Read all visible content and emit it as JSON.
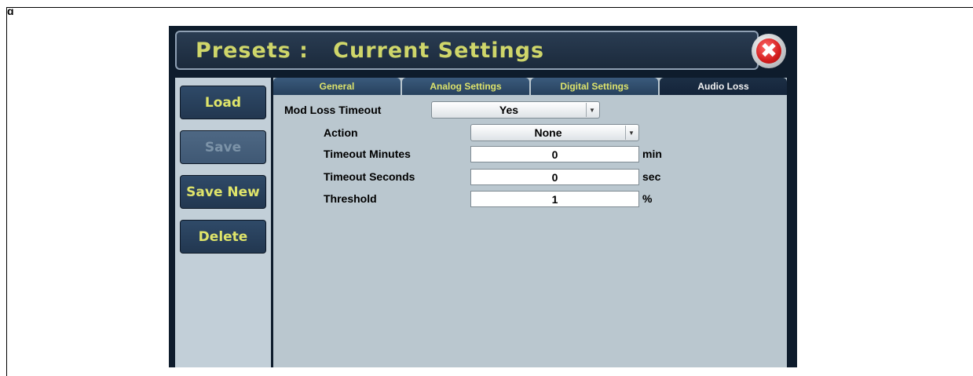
{
  "corner_letter": "g",
  "title": "Presets :   Current Settings",
  "close_icon": "✖",
  "sidebar": {
    "load": "Load",
    "save": "Save",
    "save_new": "Save New",
    "delete": "Delete"
  },
  "tabs": [
    "General",
    "Analog Settings",
    "Digital Settings",
    "Audio Loss"
  ],
  "active_tab": "Audio Loss",
  "form": {
    "mod_loss_timeout": {
      "label": "Mod Loss Timeout",
      "value": "Yes"
    },
    "action": {
      "label": "Action",
      "value": "None"
    },
    "timeout_minutes": {
      "label": "Timeout Minutes",
      "value": "0",
      "unit": "min"
    },
    "timeout_seconds": {
      "label": "Timeout Seconds",
      "value": "0",
      "unit": "sec"
    },
    "threshold": {
      "label": "Threshold",
      "value": "1",
      "unit": "%"
    }
  },
  "colors": {
    "accent_text": "#dde36c",
    "panel": "#bac7cf",
    "sidebar": "#c2cfd8",
    "button": "#2f4a68"
  }
}
